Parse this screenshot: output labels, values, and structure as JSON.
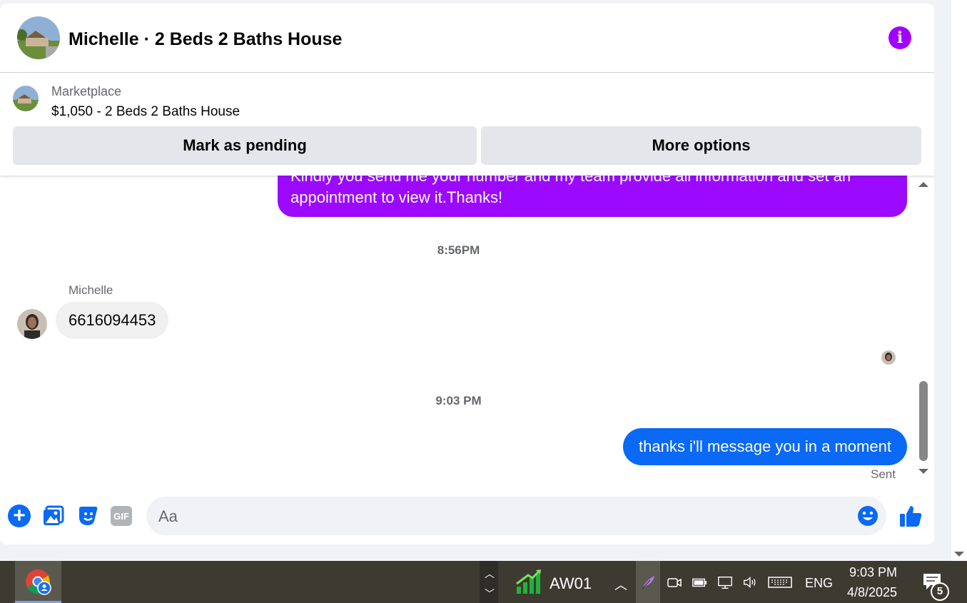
{
  "header": {
    "title": "Michelle · 2 Beds 2 Baths House"
  },
  "listing": {
    "source_label": "Marketplace",
    "title": "$1,050 - 2 Beds 2 Baths House",
    "mark_pending_label": "Mark as pending",
    "more_options_label": "More options"
  },
  "messages": {
    "outgoing_1_text": "Kindly you send me your number and my team provide all information and set an appointment to view it.Thanks!",
    "timestamp_1": "8:56PM",
    "sender_name": "Michelle",
    "incoming_1_text": "6616094453",
    "timestamp_2": "9:03 PM",
    "outgoing_2_text": "thanks i'll message you in a moment",
    "status": "Sent"
  },
  "composer": {
    "placeholder": "Aa",
    "gif_label": "GIF"
  },
  "taskbar": {
    "app_label": "AW01",
    "language": "ENG",
    "time": "9:03 PM",
    "date": "4/8/2025",
    "notification_count": "5"
  },
  "colors": {
    "accent_purple": "#9b09ff",
    "messenger_blue": "#0a69f5",
    "info_purple": "#a100ff"
  },
  "icons": [
    "info-icon",
    "plus-icon",
    "image-icon",
    "sticker-icon",
    "gif-icon",
    "emoji-icon",
    "like-icon",
    "chrome-icon",
    "aw-app-icon",
    "feather-icon",
    "meet-icon",
    "battery-icon",
    "network-icon",
    "volume-icon",
    "keyboard-icon",
    "notification-icon"
  ]
}
